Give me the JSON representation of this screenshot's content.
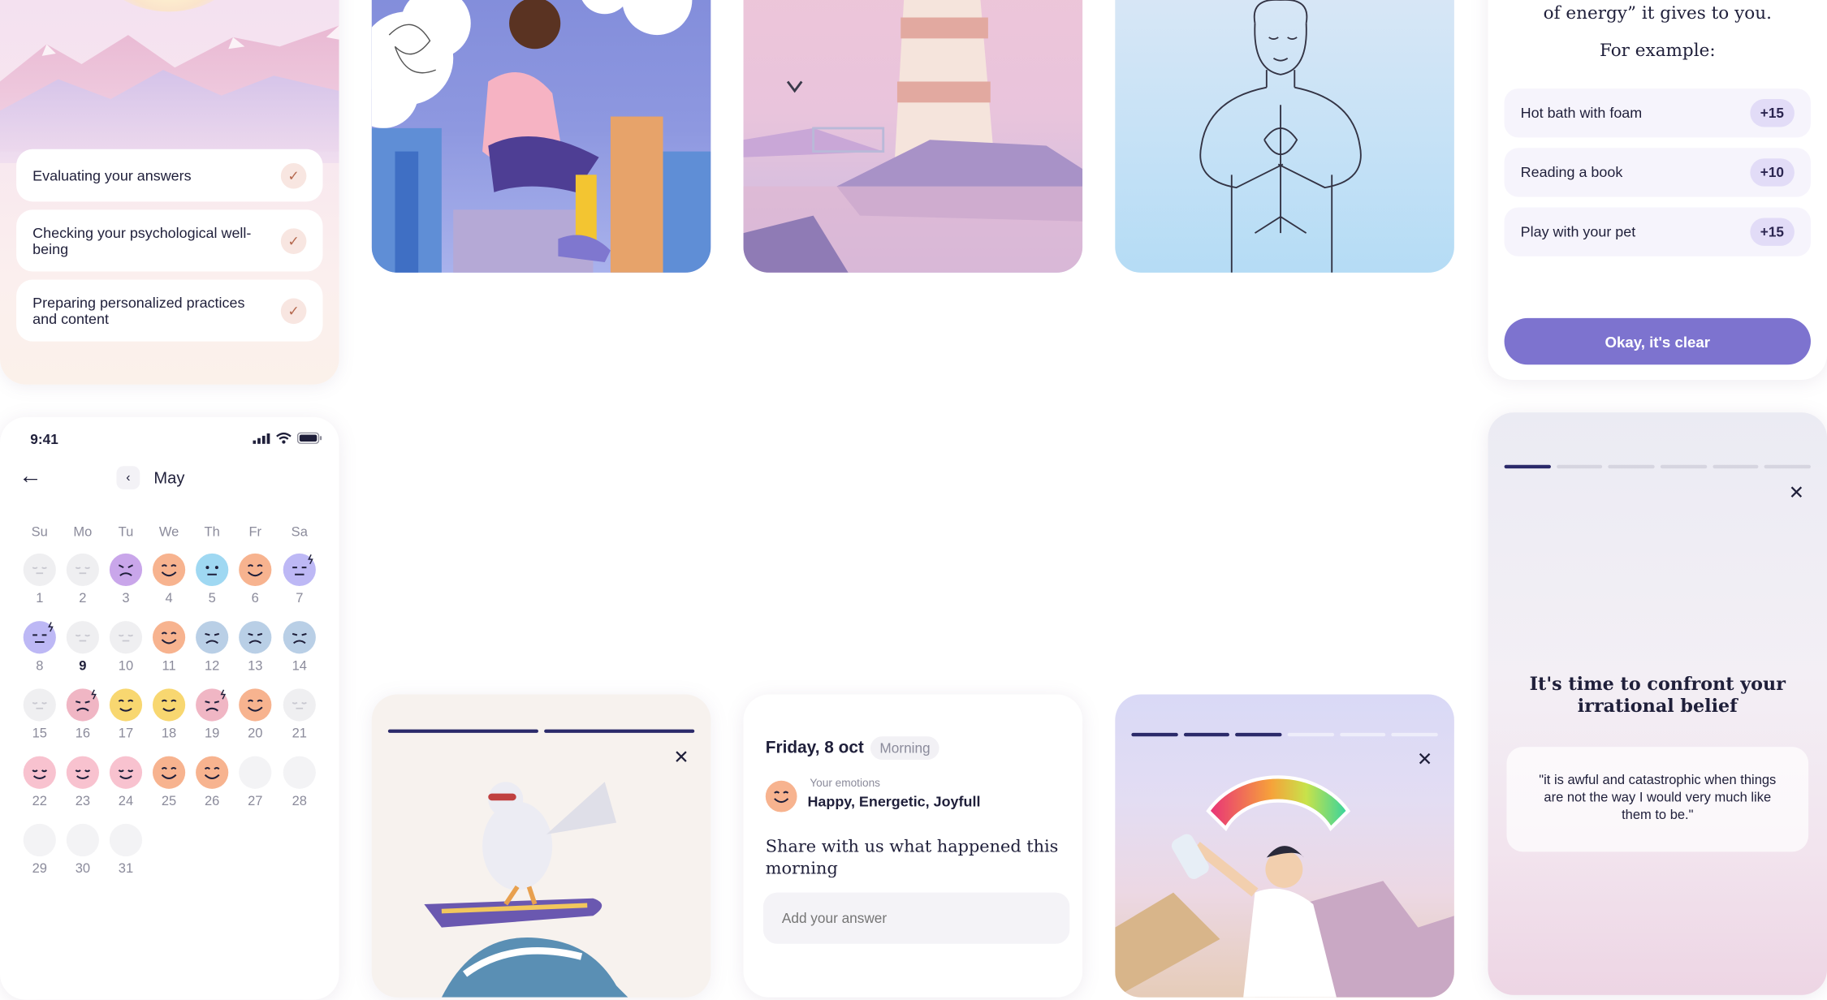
{
  "loading": {
    "steps": [
      {
        "label": "Evaluating your answers"
      },
      {
        "label": "Checking your psychological well-being"
      },
      {
        "label": "Preparing personalized practices and content"
      }
    ]
  },
  "calendar": {
    "time": "9:41",
    "month": "May",
    "weekdays": [
      "Su",
      "Mo",
      "Tu",
      "We",
      "Th",
      "Fr",
      "Sa"
    ],
    "days": [
      {
        "n": "1",
        "mood": "none"
      },
      {
        "n": "2",
        "mood": "none"
      },
      {
        "n": "3",
        "mood": "angry"
      },
      {
        "n": "4",
        "mood": "happy"
      },
      {
        "n": "5",
        "mood": "neutral"
      },
      {
        "n": "6",
        "mood": "happy"
      },
      {
        "n": "7",
        "mood": "tired"
      },
      {
        "n": "8",
        "mood": "tired"
      },
      {
        "n": "9",
        "mood": "none"
      },
      {
        "n": "10",
        "mood": "none"
      },
      {
        "n": "11",
        "mood": "happy"
      },
      {
        "n": "12",
        "mood": "sad"
      },
      {
        "n": "13",
        "mood": "sad"
      },
      {
        "n": "14",
        "mood": "sad"
      },
      {
        "n": "15",
        "mood": "none"
      },
      {
        "n": "16",
        "mood": "annoyed"
      },
      {
        "n": "17",
        "mood": "content"
      },
      {
        "n": "18",
        "mood": "content"
      },
      {
        "n": "19",
        "mood": "annoyed"
      },
      {
        "n": "20",
        "mood": "happy"
      },
      {
        "n": "21",
        "mood": "none"
      },
      {
        "n": "22",
        "mood": "calm"
      },
      {
        "n": "23",
        "mood": "calm"
      },
      {
        "n": "24",
        "mood": "calm"
      },
      {
        "n": "25",
        "mood": "happy"
      },
      {
        "n": "26",
        "mood": "happy"
      },
      {
        "n": "27",
        "mood": "empty"
      },
      {
        "n": "28",
        "mood": "empty"
      },
      {
        "n": "29",
        "mood": "empty"
      },
      {
        "n": "30",
        "mood": "empty"
      },
      {
        "n": "31",
        "mood": "empty"
      }
    ],
    "today": "9",
    "mood_colors": {
      "none": "#efeff1",
      "angry": "#c9a6ea",
      "happy": "#f7b38f",
      "neutral": "#9fd8f2",
      "tired": "#bdb8f5",
      "sad": "#b9cfe6",
      "annoyed": "#f0b6c4",
      "content": "#f8d770",
      "calm": "#f8c2cf",
      "empty": "#f3f3f5"
    }
  },
  "energy": {
    "title": "of energy” it gives to you.",
    "example_label": "For example:",
    "items": [
      {
        "label": "Hot bath with foam",
        "value": "+15"
      },
      {
        "label": "Reading a book",
        "value": "+10"
      },
      {
        "label": "Play with your pet",
        "value": "+15"
      }
    ],
    "button": "Okay, it's clear",
    "accent": "#7d73cf"
  },
  "belief": {
    "title": "It's time to confront your irrational belief",
    "quote": "\"it is awful and catastrophic when things are not the way I would very much like them to be.\"",
    "close_icon": "close-icon"
  },
  "journal": {
    "date": "Friday, 8 oct",
    "period": "Morning",
    "emotions_label": "Your emotions",
    "emotions": "Happy, Energetic, Joyfull",
    "prompt": "Share with us what happened this morning",
    "placeholder": "Add your answer"
  }
}
